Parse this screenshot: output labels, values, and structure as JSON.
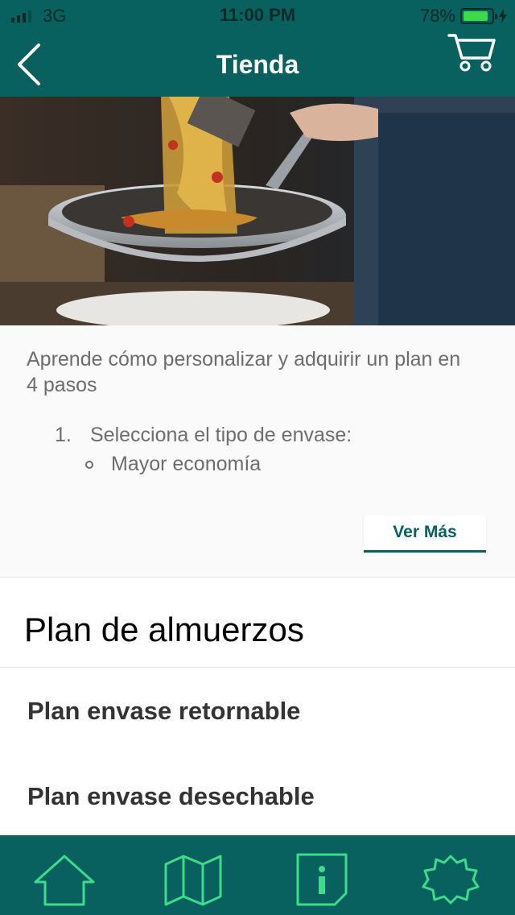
{
  "status_bar": {
    "carrier": "3G",
    "time": "11:00 PM",
    "battery": "78%"
  },
  "header": {
    "title": "Tienda"
  },
  "hero": {
    "description": "pasta-pan-photo"
  },
  "info": {
    "intro": "Aprende cómo personalizar y adquirir un plan en 4 pasos",
    "step_number": "1.",
    "step_text": "Selecciona el tipo de envase:",
    "bullet_text": "Mayor economía",
    "more_button": "Ver Más"
  },
  "section": {
    "title": "Plan de almuerzos"
  },
  "plans": [
    {
      "label": "Plan envase retornable"
    },
    {
      "label": "Plan envase desechable"
    }
  ],
  "tabbar": {
    "tabs": [
      {
        "icon": "home-icon"
      },
      {
        "icon": "map-icon"
      },
      {
        "icon": "info-icon"
      },
      {
        "icon": "settings-icon"
      }
    ]
  },
  "colors": {
    "primary": "#08605f",
    "accent": "#3ddb8a",
    "battery": "#3ddb49"
  }
}
